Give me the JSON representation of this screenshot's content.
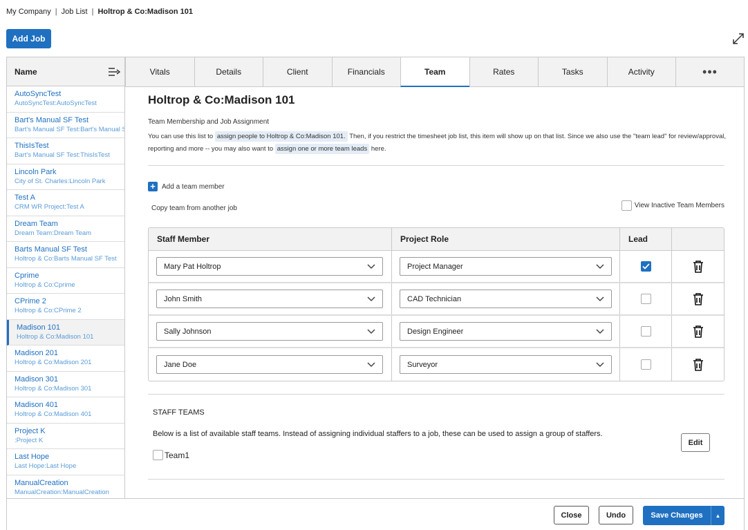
{
  "breadcrumb": {
    "company": "My Company",
    "sep": "|",
    "job_list": "Job List",
    "current": "Holtrop & Co:Madison 101"
  },
  "toolbar": {
    "add_job": "Add Job"
  },
  "left_panel": {
    "header": "Name",
    "jobs": [
      {
        "name": "AutoSyncTest",
        "sub": "AutoSyncTest:AutoSyncTest"
      },
      {
        "name": "Bart's Manual SF Test",
        "sub": "Bart's Manual SF Test:Bart's Manual SF Test"
      },
      {
        "name": "ThisIsTest",
        "sub": "Bart's Manual SF Test:ThisIsTest"
      },
      {
        "name": "Lincoln Park",
        "sub": "City of St. Charles:Lincoln Park"
      },
      {
        "name": "Test A",
        "sub": "CRM WR Project:Test A"
      },
      {
        "name": "Dream Team",
        "sub": "Dream Team:Dream Team"
      },
      {
        "name": "Barts Manual SF Test",
        "sub": "Holtrop & Co:Barts Manual SF Test"
      },
      {
        "name": "Cprime",
        "sub": "Holtrop & Co:Cprime"
      },
      {
        "name": "CPrime 2",
        "sub": "Holtrop & Co:CPrime 2"
      },
      {
        "name": "Madison 101",
        "sub": "Holtrop & Co:Madison 101"
      },
      {
        "name": "Madison 201",
        "sub": "Holtrop & Co:Madison 201"
      },
      {
        "name": "Madison 301",
        "sub": "Holtrop & Co:Madison 301"
      },
      {
        "name": "Madison 401",
        "sub": "Holtrop & Co:Madison 401"
      },
      {
        "name": "Project K",
        "sub": ":Project K"
      },
      {
        "name": "Last Hope",
        "sub": "Last Hope:Last Hope"
      },
      {
        "name": "ManualCreation",
        "sub": "ManualCreation:ManualCreation"
      }
    ],
    "active_index": 9
  },
  "tabs": [
    "Vitals",
    "Details",
    "Client",
    "Financials",
    "Team",
    "Rates",
    "Tasks",
    "Activity",
    "•••"
  ],
  "active_tab": "Team",
  "main": {
    "title": "Holtrop & Co:Madison 101",
    "section_title": "Team Membership and Job Assignment",
    "intro_1": "You can use this list to",
    "intro_link_1": "assign people to Holtrop & Co:Madison 101.",
    "intro_2": "Then, if you restrict the timesheet job list, this item will show up on that list. Since we also use the \"team lead\" for review/approval, reporting and more -- you may also want to",
    "intro_link_2": "assign one or more team leads",
    "intro_3": "here.",
    "add_member": "Add a team member",
    "copy_team": "Copy team from another job",
    "view_inactive": "View Inactive Team Members"
  },
  "table": {
    "headers": [
      "Staff Member",
      "Project Role",
      "Lead",
      ""
    ],
    "rows": [
      {
        "staff": "Mary Pat Holtrop",
        "role": "Project Manager",
        "lead": true
      },
      {
        "staff": "John Smith",
        "role": "CAD Technician",
        "lead": false
      },
      {
        "staff": "Sally Johnson",
        "role": "Design Engineer",
        "lead": false
      },
      {
        "staff": "Jane Doe",
        "role": "Surveyor",
        "lead": false
      }
    ]
  },
  "staff_teams": {
    "title": "STAFF TEAMS",
    "description": "Below is a list of available staff teams. Instead of assigning individual staffers to a job, these can be used to assign a group of staffers.",
    "edit": "Edit",
    "teams": [
      "Team1"
    ]
  },
  "footer": {
    "close": "Close",
    "undo": "Undo",
    "save": "Save Changes"
  },
  "colors": {
    "accent": "#1f70c1"
  }
}
